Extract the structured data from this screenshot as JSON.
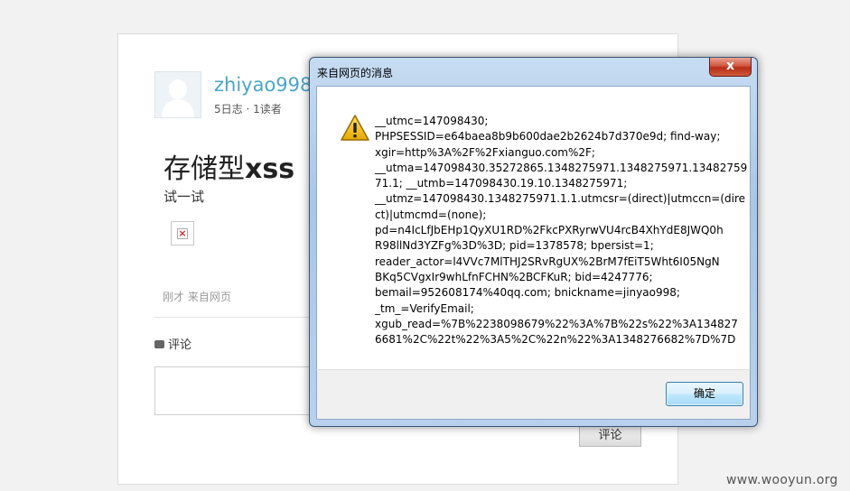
{
  "blog": {
    "username": "zhiyao998",
    "meta": "5日志 · 1读者",
    "post_title_cn": "存储型",
    "post_title_en": "xss",
    "post_body": "试一试",
    "timestamp": "刚才 来自网页",
    "comment_heading": "评论",
    "comment_submit": "评论"
  },
  "watermark": "www.wooyun.org",
  "dialog": {
    "title": "来自网页的消息",
    "close_symbol": "x",
    "ok_label": "确定",
    "message_lines": [
      "__utmc=147098430;",
      "PHPSESSID=e64baea8b9b600dae2b2624b7d370e9d; find-way;",
      "xgir=http%3A%2F%2Fxianguo.com%2F;",
      "__utma=147098430.35272865.1348275971.1348275971.13482759",
      "71.1; __utmb=147098430.19.10.1348275971;",
      "__utmz=147098430.1348275971.1.1.utmcsr=(direct)|utmccn=(dire",
      "ct)|utmcmd=(none);",
      "pd=n4IcLfJbEHp1QyXU1RD%2FkcPXRyrwVU4rcB4XhYdE8JWQ0h",
      "R98llNd3YZFg%3D%3D; pid=1378578; bpersist=1;",
      "reader_actor=l4VVc7MlTHJ2SRvRgUX%2BrM7fEiT5Wht6I05NgN",
      "BKq5CVgxIr9whLfnFCHN%2BCFKuR; bid=4247776;",
      "bemail=952608174%40qq.com; bnickname=jinyao998;",
      "_tm_=VerifyEmail;",
      "xgub_read=%7B%2238098679%22%3A%7B%22s%22%3A134827",
      "6681%2C%22t%22%3A5%2C%22n%22%3A1348276682%7D%7D"
    ]
  },
  "colors": {
    "username": "#4aa6c8",
    "dialog_frame": "#b9d1ec",
    "close_button": "#c7452b"
  }
}
